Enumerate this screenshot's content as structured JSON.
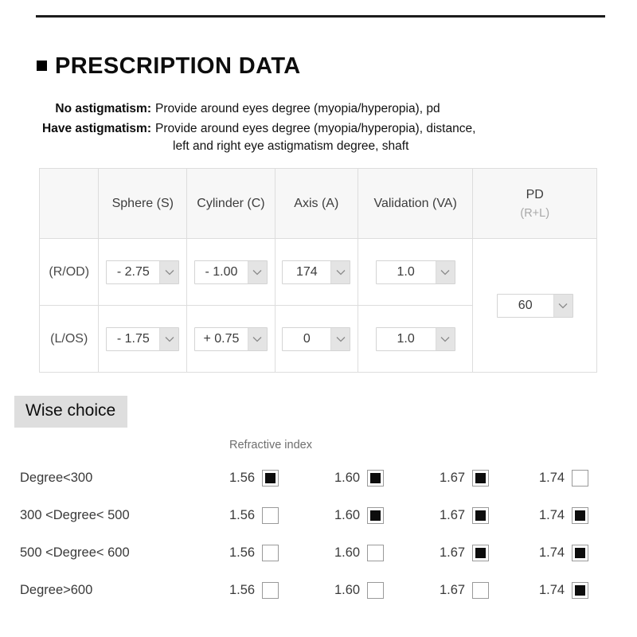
{
  "top_rule": {
    "name": "horizontal-rule"
  },
  "section": {
    "bullet": "black-square-bullet",
    "title": "PRESCRIPTION DATA"
  },
  "astigmatism": {
    "rows": [
      {
        "label": "No astigmatism:",
        "desc_line1": "Provide around eyes degree (myopia/hyperopia), pd",
        "desc_line2": ""
      },
      {
        "label": "Have astigmatism:",
        "desc_line1": "Provide around eyes degree (myopia/hyperopia), distance,",
        "desc_line2": "left and right eye astigmatism degree, shaft"
      }
    ]
  },
  "rx_table": {
    "corner_header": "",
    "headers": [
      "Sphere (S)",
      "Cylinder (C)",
      "Axis (A)",
      "Validation (VA)"
    ],
    "pd_header_main": "PD",
    "pd_header_sub": "(R+L)",
    "rows": [
      {
        "eye": "(R/OD)",
        "sphere": "- 2.75",
        "cylinder": "- 1.00",
        "axis": "174",
        "validation": "1.0"
      },
      {
        "eye": "(L/OS)",
        "sphere": "- 1.75",
        "cylinder": "+ 0.75",
        "axis": "0",
        "validation": "1.0"
      }
    ],
    "pd_value": "60"
  },
  "wise_choice": {
    "heading": "Wise choice",
    "column_title": "Refractive index",
    "index_values": [
      "1.56",
      "1.60",
      "1.67",
      "1.74"
    ],
    "rows": [
      {
        "label": "Degree<300",
        "options": [
          {
            "value": "1.56",
            "checked": true
          },
          {
            "value": "1.60",
            "checked": true
          },
          {
            "value": "1.67",
            "checked": true
          },
          {
            "value": "1.74",
            "checked": false
          }
        ]
      },
      {
        "label": "300 <Degree< 500",
        "options": [
          {
            "value": "1.56",
            "checked": false
          },
          {
            "value": "1.60",
            "checked": true
          },
          {
            "value": "1.67",
            "checked": true
          },
          {
            "value": "1.74",
            "checked": true
          }
        ]
      },
      {
        "label": "500 <Degree< 600",
        "options": [
          {
            "value": "1.56",
            "checked": false
          },
          {
            "value": "1.60",
            "checked": false
          },
          {
            "value": "1.67",
            "checked": true
          },
          {
            "value": "1.74",
            "checked": true
          }
        ]
      },
      {
        "label": "Degree>600",
        "options": [
          {
            "value": "1.56",
            "checked": false
          },
          {
            "value": "1.60",
            "checked": false
          },
          {
            "value": "1.67",
            "checked": false
          },
          {
            "value": "1.74",
            "checked": true
          }
        ]
      }
    ]
  },
  "colors": {
    "rule": "#1c1c1c",
    "header_bg": "#f7f7f7",
    "border": "#dddddd",
    "select_border": "#d4d4d4",
    "select_arrow_bg": "#e4e4e4",
    "heading_highlight": "#dedede",
    "muted_text": "#a8a8a8",
    "body_text": "#3a3a3a",
    "checkbox_fill": "#0d0d0d"
  }
}
